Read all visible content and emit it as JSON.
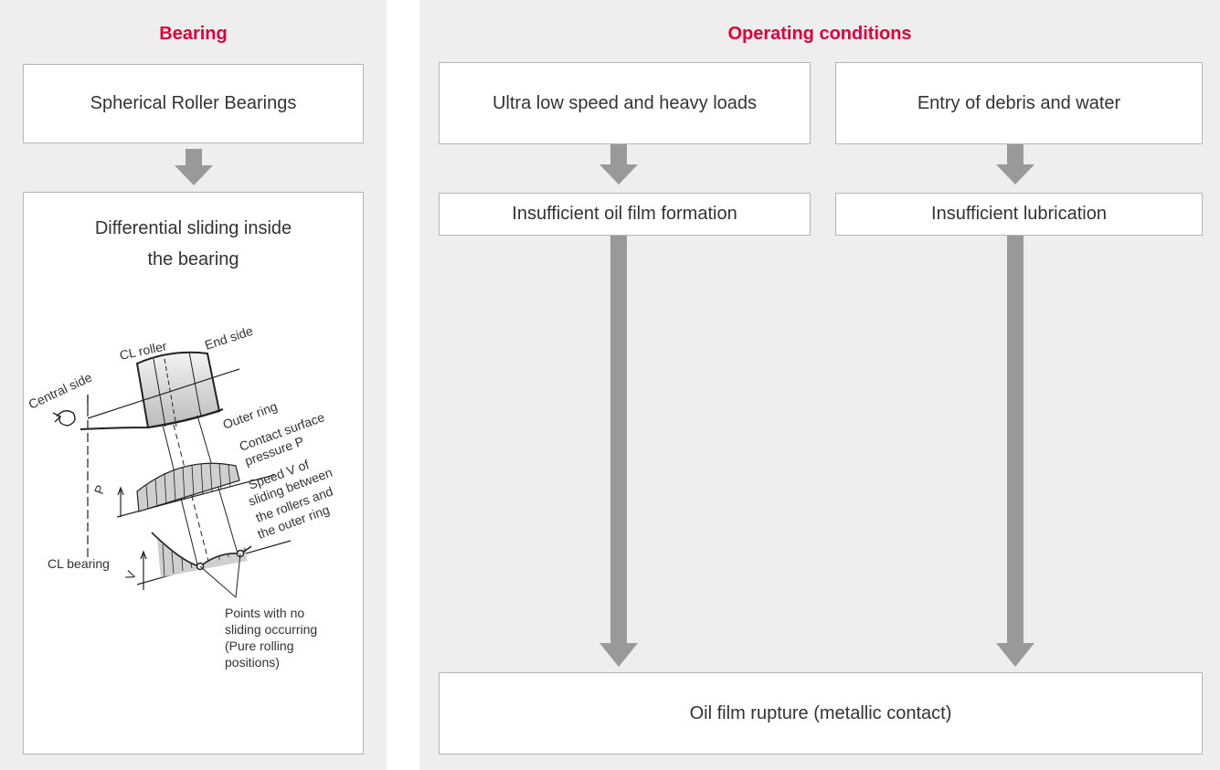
{
  "bearing_panel": {
    "title": "Bearing",
    "box_top": "Spherical Roller Bearings",
    "box_bottom_line1": "Differential sliding inside",
    "box_bottom_line2": "the bearing"
  },
  "illustration": {
    "label_central_side": "Central side",
    "label_cl_roller": "CL roller",
    "label_end_side": "End side",
    "label_outer_ring": "Outer ring",
    "label_contact_line1": "Contact surface",
    "label_contact_line2": "pressure P",
    "label_speed_line1": "Speed V of",
    "label_speed_line2": "sliding between",
    "label_speed_line3": "the rollers and",
    "label_speed_line4": "the outer ring",
    "label_p": "P",
    "label_v": "V",
    "label_cl_bearing": "CL bearing",
    "label_points_line1": "Points with no",
    "label_points_line2": "sliding occurring",
    "label_points_line3": "(Pure rolling",
    "label_points_line4": "positions)"
  },
  "operating_panel": {
    "title": "Operating conditions",
    "cause_1": "Ultra low speed and heavy loads",
    "cause_2": "Entry of debris and water",
    "effect_1": "Insufficient oil film formation",
    "effect_2": "Insufficient lubrication",
    "result": "Oil film rupture (metallic contact)"
  },
  "colors": {
    "accent": "#e4003a",
    "panel_bg": "#eeeeee",
    "arrow": "#999999"
  }
}
